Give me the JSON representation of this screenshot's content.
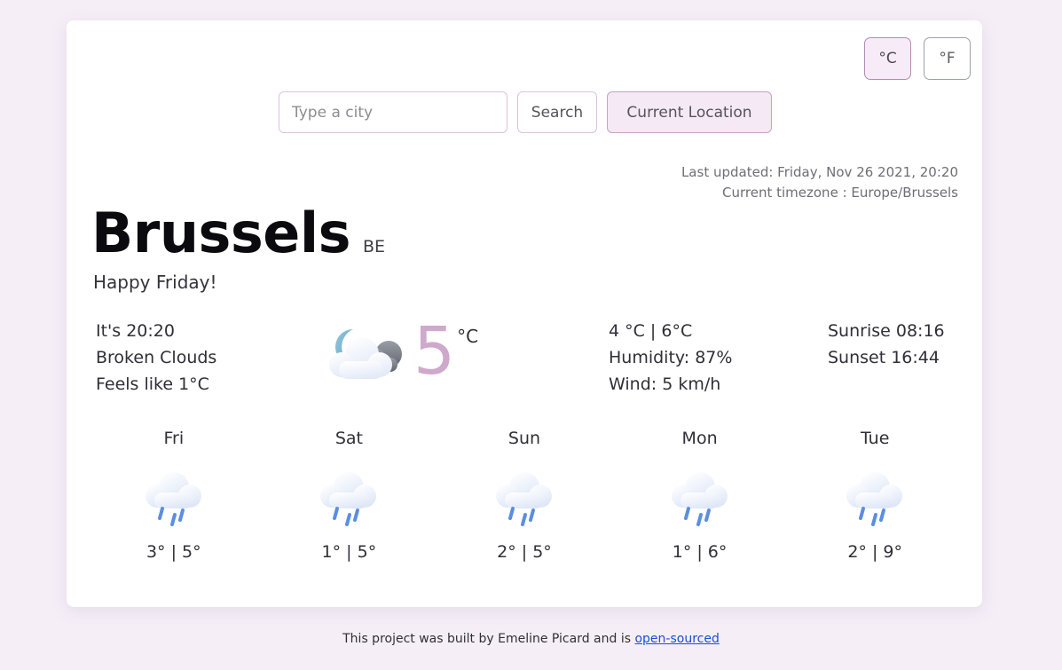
{
  "units": {
    "celsius_label": "°C",
    "fahrenheit_label": "°F",
    "active": "celsius",
    "active_bg": "#f4e9f4",
    "active_border": "#b58ab4"
  },
  "search": {
    "placeholder": "Type a city",
    "value": "",
    "search_label": "Search",
    "current_location_label": "Current Location"
  },
  "meta": {
    "last_updated": "Last updated: Friday, Nov 26 2021, 20:20",
    "timezone": "Current timezone : Europe/Brussels"
  },
  "location": {
    "city": "Brussels",
    "country_code": "BE",
    "greeting": "Happy Friday!"
  },
  "current": {
    "local_time": "It's 20:20",
    "description": "Broken Clouds",
    "feels_like": "Feels like 1°C",
    "icon": "night-broken-clouds-icon",
    "temperature": "5",
    "temperature_unit": "°C",
    "temperature_color": "#cfa9cb",
    "min_max": "4 °C | 6°C",
    "humidity": "Humidity: 87%",
    "wind": "Wind: 5 km/h",
    "sunrise": "Sunrise 08:16",
    "sunset": "Sunset 16:44"
  },
  "forecast": [
    {
      "day": "Fri",
      "icon": "rain-cloud-icon",
      "temps": "3° | 5°"
    },
    {
      "day": "Sat",
      "icon": "rain-cloud-icon",
      "temps": "1° | 5°"
    },
    {
      "day": "Sun",
      "icon": "rain-cloud-icon",
      "temps": "2° | 5°"
    },
    {
      "day": "Mon",
      "icon": "rain-cloud-icon",
      "temps": "1° | 6°"
    },
    {
      "day": "Tue",
      "icon": "rain-cloud-icon",
      "temps": "2° | 9°"
    }
  ],
  "footer": {
    "text_before": "This project was built by Emeline Picard and is ",
    "link_label": "open-sourced"
  },
  "colors": {
    "page_background": "#f5eef7",
    "card_background": "#ffffff",
    "link": "#1a4fd6"
  }
}
